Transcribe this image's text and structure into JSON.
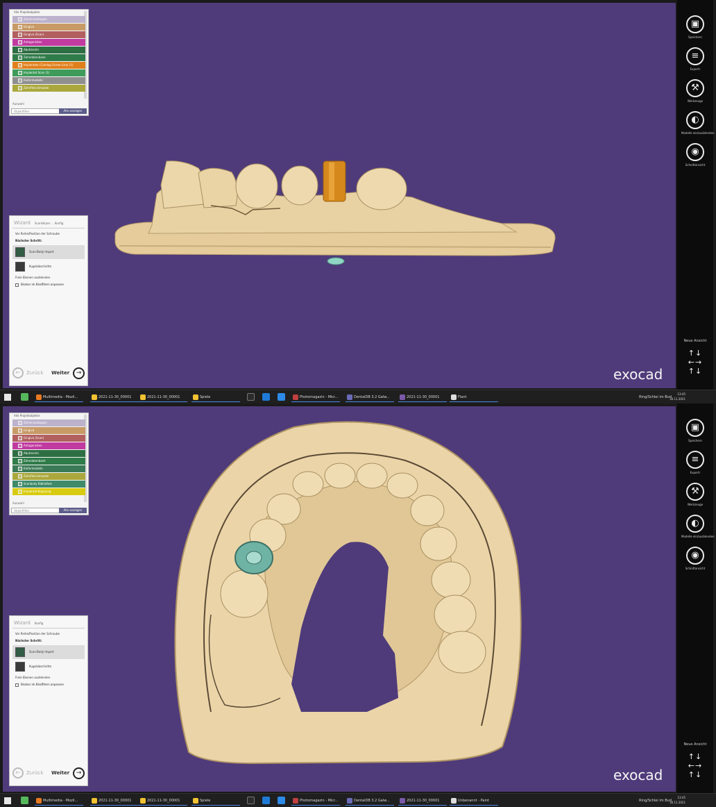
{
  "top": {
    "object_tree": {
      "header": "Alle Projektobjekte",
      "items": [
        {
          "label": "Zahnkranzbogen",
          "color": "#bcb2cc"
        },
        {
          "label": "Gingiva",
          "color": "#c89a66"
        },
        {
          "label": "Gingiva (Scan)",
          "color": "#b25f5f"
        },
        {
          "label": "Antagonisten",
          "color": "#c03aa0"
        },
        {
          "label": "Abutments",
          "color": "#2e6e43"
        },
        {
          "label": "Zahndatenbank",
          "color": "#2f7b49"
        },
        {
          "label": "Implantate (Camlog Screw-Line) (1)",
          "color": "#e0801d"
        },
        {
          "label": "Implantat Scan (1)",
          "color": "#3f9b5a"
        },
        {
          "label": "Kiefermodelle",
          "color": "#8f8f8f"
        },
        {
          "label": "Zahnfleischmaske",
          "color": "#aaa83c"
        }
      ],
      "footer": "Auswahl",
      "filter_placeholder": "Objektfilter",
      "show_all": "Alle anzeigen"
    },
    "wizard": {
      "title": "Wizard",
      "subtitle": "Scankörper ... Konfig",
      "info": "Vor Reihe/Position der Schraube",
      "heading": "Nächster Schritt:",
      "option_selected": "Scan-Body Import",
      "option_other": "Kugelabschnitte",
      "link": "Freie Ebenen ausblenden",
      "checkbox": "Bisskor im Bissfiltern anpassen",
      "back": "Zurück",
      "next": "Weiter"
    },
    "logo": "exocad"
  },
  "bottom": {
    "object_tree": {
      "header": "Alle Projektobjekte",
      "items": [
        {
          "label": "Zahnkranzbogen",
          "color": "#bcb2cc"
        },
        {
          "label": "Gingiva",
          "color": "#c89a66"
        },
        {
          "label": "Gingiva (Scan)",
          "color": "#b25f5f"
        },
        {
          "label": "Antagonisten",
          "color": "#c03aa0"
        },
        {
          "label": "Abutments",
          "color": "#2e6e43"
        },
        {
          "label": "Zahndatenbank",
          "color": "#2f7b49"
        },
        {
          "label": "Kiefermodelle",
          "color": "#3b7a56"
        },
        {
          "label": "Zahnfleischmaske",
          "color": "#aaa83c"
        },
        {
          "label": "Scanbody Bibliothek",
          "color": "#3f8a69"
        },
        {
          "label": "Implantat-Kopplung",
          "color": "#d9cc10"
        }
      ],
      "footer": "Auswahl",
      "filter_placeholder": "Objektfilter",
      "show_all": "Alle anzeigen"
    },
    "wizard": {
      "title": "Wizard",
      "subtitle": "Konfig",
      "info": "Vor Reihe/Position der Schraube",
      "heading": "Nächster Schritt:",
      "option_selected": "Scan-Body Import",
      "option_other": "Kugelabschnitte",
      "link": "Freie Ebenen ausblenden",
      "checkbox": "Bisskor im Bissfiltern anpassen",
      "back": "Zurück",
      "next": "Weiter"
    },
    "logo": "exocad"
  },
  "right_toolbar": {
    "buttons": [
      {
        "label": "Speichern",
        "icon": "save-icon",
        "glyph": "▣"
      },
      {
        "label": "Expertr",
        "icon": "expert-icon",
        "glyph": "≡"
      },
      {
        "label": "Werkzeuge",
        "icon": "tools-icon",
        "glyph": "⚒"
      },
      {
        "label": "Modelle ein/ausblenden",
        "icon": "tooth-visibility-icon",
        "glyph": "◐"
      },
      {
        "label": "Schnittansicht",
        "icon": "section-view-icon",
        "glyph": "◉"
      }
    ],
    "nav_label": "Neue Ansicht",
    "nav_arrows": "↑↓\n←→\n↑↓"
  },
  "taskbar": {
    "items": [
      {
        "label": "Multimedia - Mozil...",
        "color": "#e87a22"
      },
      {
        "label": "2021-11-30_00001",
        "color": "#f1c232"
      },
      {
        "label": "2021-11-30_00001",
        "color": "#f1c232"
      },
      {
        "label": "Spiele",
        "color": "#f1c232"
      },
      {
        "label": "Photomagazin - Micr...",
        "color": "#c04040"
      },
      {
        "label": "DentalDB 3.2 Galw...",
        "color": "#6b6bb8"
      },
      {
        "label": "2021-11-30_00001",
        "color": "#7a5aa8"
      },
      {
        "label": "Flant",
        "color": "#dddddd"
      }
    ],
    "bottom_item_last": "Unbenannt - Paint",
    "tray": "Ring/Schlei im Bud",
    "time": "13:45",
    "date": "30.11.2021"
  }
}
